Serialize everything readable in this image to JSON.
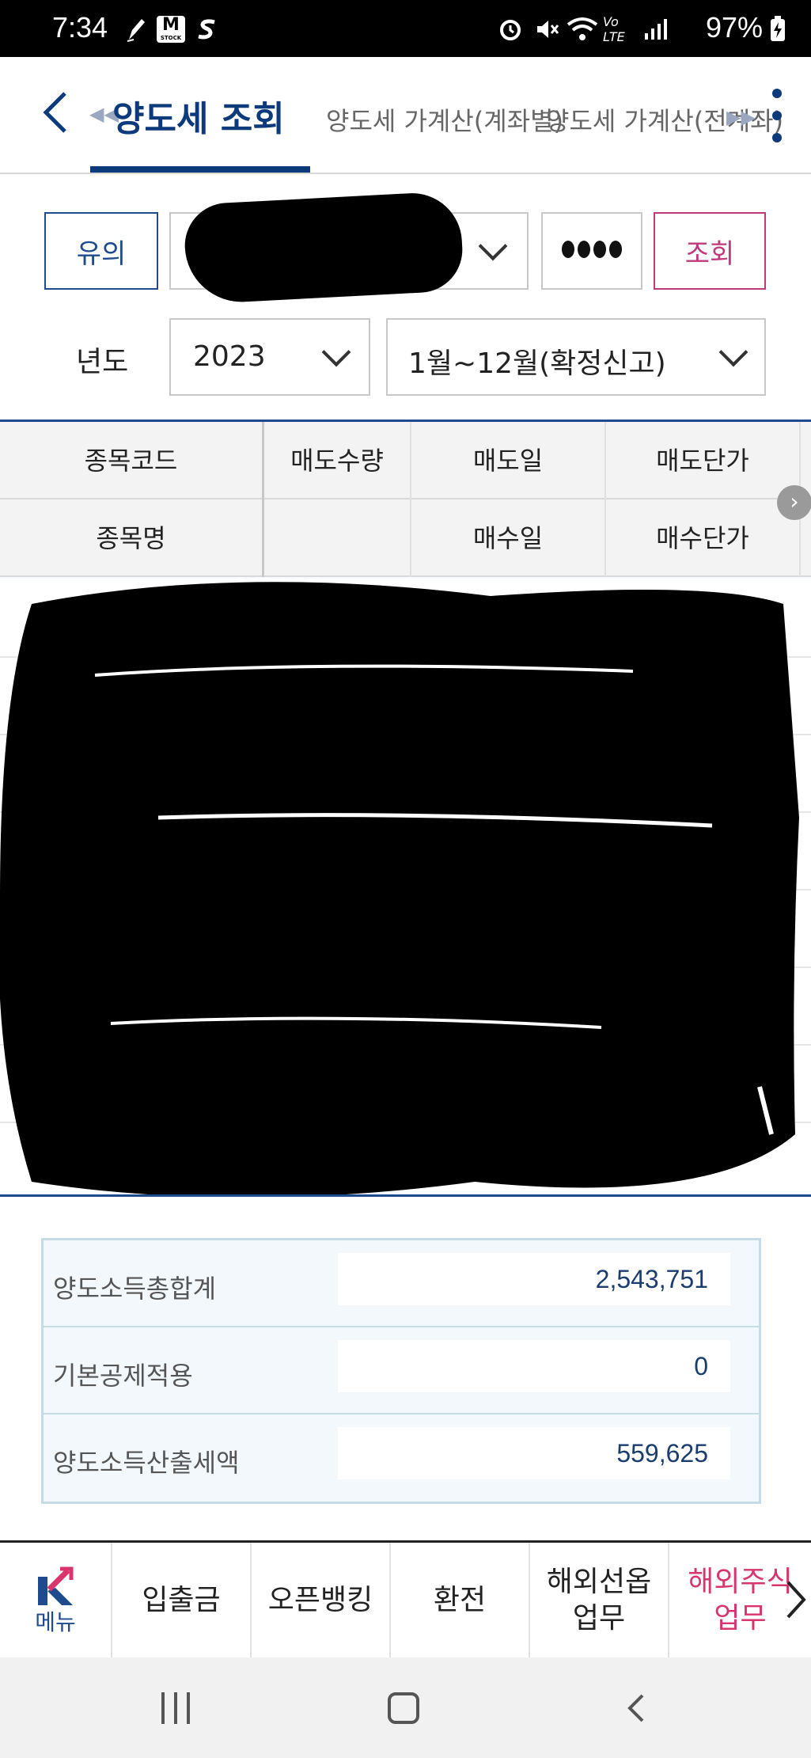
{
  "status_bar": {
    "time": "7:34",
    "battery": "97%",
    "volte": "Vo LTE",
    "icons": [
      "pen-icon",
      "m-stock-icon",
      "s-icon",
      "alarm-icon",
      "mute-icon",
      "wifi-icon",
      "volte-icon",
      "signal-icon",
      "battery-charging-icon"
    ],
    "mstock_label": "M",
    "mstock_sub": "STOCK"
  },
  "header": {
    "tabs": [
      {
        "label": "양도세 조회",
        "active": true
      },
      {
        "label": "양도세 가계산(계좌별)",
        "active": false
      },
      {
        "label": "양도세 가계산(전계좌)",
        "active": false
      }
    ],
    "accent_color": "#0d3a7a"
  },
  "search": {
    "notice_label": "유의",
    "password_mask": "●●●●",
    "query_label": "조회",
    "year_label": "년도",
    "year_value": "2023",
    "period_value": "1월~12월(확정신고)"
  },
  "table": {
    "header_row1": [
      "종목코드",
      "매도수량",
      "매도일",
      "매도단가"
    ],
    "header_row2": [
      "종목명",
      "",
      "매수일",
      "매수단가"
    ]
  },
  "summary": {
    "rows": [
      {
        "label": "양도소득총합계",
        "value": "2,543,751"
      },
      {
        "label": "기본공제적용",
        "value": "0"
      },
      {
        "label": "양도소득산출세액",
        "value": "559,625"
      }
    ]
  },
  "quick_menu": {
    "menu_label": "메뉴",
    "items": [
      "입출금",
      "오픈뱅킹",
      "환전",
      "해외선옵\n업무",
      "해외주식\n업무"
    ],
    "active_color": "#d8356f"
  }
}
